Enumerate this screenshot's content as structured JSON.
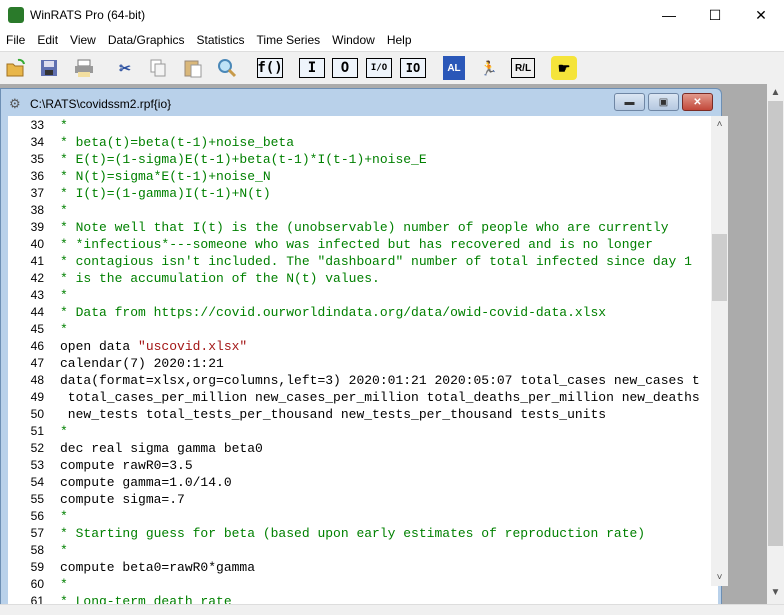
{
  "app": {
    "title": "WinRATS Pro (64-bit)"
  },
  "window_buttons": {
    "minimize": "—",
    "maximize": "☐",
    "close": "✕"
  },
  "menu": [
    "File",
    "Edit",
    "View",
    "Data/Graphics",
    "Statistics",
    "Time Series",
    "Window",
    "Help"
  ],
  "toolbar": {
    "icons": [
      "open-icon",
      "save-icon",
      "print-icon",
      "cut-icon",
      "copy-icon",
      "paste-icon",
      "find-icon"
    ],
    "text_buttons": [
      "f()",
      "I",
      "O",
      "I/O",
      "IO"
    ]
  },
  "document": {
    "title": "C:\\RATS\\covidssm2.rpf{io}",
    "lines": [
      {
        "n": "33",
        "text": "*",
        "kind": "comment"
      },
      {
        "n": "34",
        "text": "* beta(t)=beta(t-1)+noise_beta",
        "kind": "comment"
      },
      {
        "n": "35",
        "text": "* E(t)=(1-sigma)E(t-1)+beta(t-1)*I(t-1)+noise_E",
        "kind": "comment"
      },
      {
        "n": "36",
        "text": "* N(t)=sigma*E(t-1)+noise_N",
        "kind": "comment"
      },
      {
        "n": "37",
        "text": "* I(t)=(1-gamma)I(t-1)+N(t)",
        "kind": "comment"
      },
      {
        "n": "38",
        "text": "*",
        "kind": "comment"
      },
      {
        "n": "39",
        "text": "* Note well that I(t) is the (unobservable) number of people who are currently",
        "kind": "comment"
      },
      {
        "n": "40",
        "text": "* *infectious*---someone who was infected but has recovered and is no longer",
        "kind": "comment"
      },
      {
        "n": "41",
        "text": "* contagious isn't included. The \"dashboard\" number of total infected since day 1",
        "kind": "comment"
      },
      {
        "n": "42",
        "text": "* is the accumulation of the N(t) values.",
        "kind": "comment"
      },
      {
        "n": "43",
        "text": "*",
        "kind": "comment"
      },
      {
        "n": "44",
        "text": "* Data from https://covid.ourworldindata.org/data/owid-covid-data.xlsx",
        "kind": "comment"
      },
      {
        "n": "45",
        "text": "*",
        "kind": "comment"
      },
      {
        "n": "46",
        "text": "open data ",
        "kind": "code",
        "string": "\"uscovid.xlsx\""
      },
      {
        "n": "47",
        "text": "calendar(7) 2020:1:21",
        "kind": "code"
      },
      {
        "n": "48",
        "text": "data(format=xlsx,org=columns,left=3) 2020:01:21 2020:05:07 total_cases new_cases t",
        "kind": "code"
      },
      {
        "n": "49",
        "text": " total_cases_per_million new_cases_per_million total_deaths_per_million new_deaths",
        "kind": "code"
      },
      {
        "n": "50",
        "text": " new_tests total_tests_per_thousand new_tests_per_thousand tests_units",
        "kind": "code"
      },
      {
        "n": "51",
        "text": "*",
        "kind": "comment"
      },
      {
        "n": "52",
        "text": "dec real sigma gamma beta0",
        "kind": "code"
      },
      {
        "n": "53",
        "text": "compute rawR0=3.5",
        "kind": "code"
      },
      {
        "n": "54",
        "text": "compute gamma=1.0/14.0",
        "kind": "code"
      },
      {
        "n": "55",
        "text": "compute sigma=.7",
        "kind": "code"
      },
      {
        "n": "56",
        "text": "*",
        "kind": "comment"
      },
      {
        "n": "57",
        "text": "* Starting guess for beta (based upon early estimates of reproduction rate)",
        "kind": "comment"
      },
      {
        "n": "58",
        "text": "*",
        "kind": "comment"
      },
      {
        "n": "59",
        "text": "compute beta0=rawR0*gamma",
        "kind": "code"
      },
      {
        "n": "60",
        "text": "*",
        "kind": "comment"
      },
      {
        "n": "61",
        "text": "* Long-term death rate",
        "kind": "comment"
      }
    ]
  },
  "colors": {
    "comment": "#008000",
    "string": "#a31515",
    "mdi_background": "#ababab",
    "child_frame": "#b9d1ea"
  }
}
